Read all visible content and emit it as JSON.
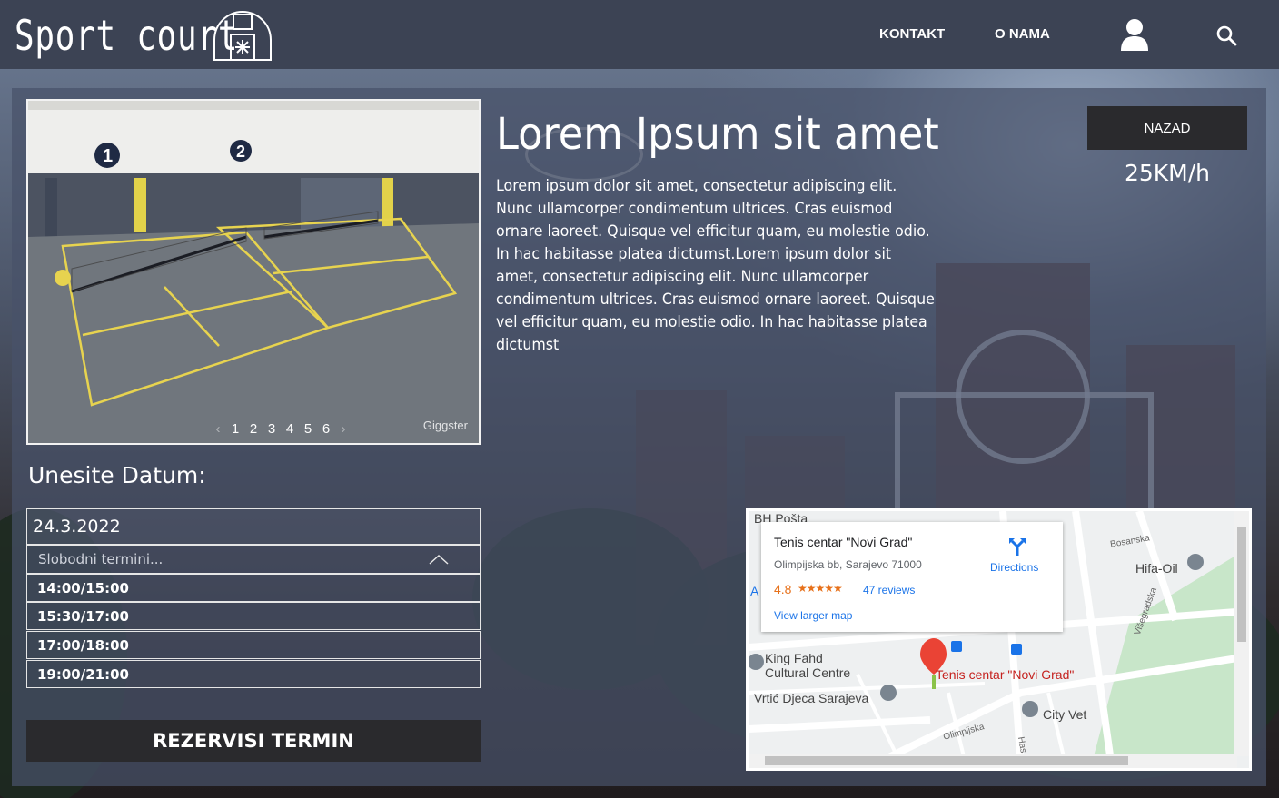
{
  "header": {
    "logo_text": "Sport court",
    "nav": [
      {
        "label": "KONTAKT"
      },
      {
        "label": "O NAMA"
      }
    ],
    "user_icon": "user-icon",
    "search_icon": "search-icon"
  },
  "gallery": {
    "pages": [
      "1",
      "2",
      "3",
      "4",
      "5",
      "6"
    ],
    "prev_arrow": "‹",
    "next_arrow": "›",
    "watermark": "Giggster"
  },
  "detail": {
    "title": "Lorem Ipsum sit amet",
    "description": "Lorem ipsum dolor sit amet, consectetur adipiscing elit. Nunc ullamcorper condimentum ultrices. Cras euismod ornare laoreet. Quisque vel efficitur quam, eu molestie odio. In hac habitasse platea dictumst.Lorem ipsum dolor sit amet, consectetur adipiscing elit. Nunc ullamcorper condimentum ultrices. Cras euismod ornare laoreet. Quisque vel efficitur quam, eu molestie odio. In hac habitasse platea dictumst",
    "back_label": "NAZAD",
    "speed": "25KM/h"
  },
  "booking": {
    "date_label": "Unesite Datum:",
    "date_value": "24.3.2022",
    "slots_placeholder": "Slobodni termini...",
    "slots": [
      "14:00/15:00",
      "15:30/17:00",
      "17:00/18:00",
      "19:00/21:00"
    ],
    "reserve_label": "REZERVISI TERMIN"
  },
  "map": {
    "place_name": "Tenis centar \"Novi Grad\"",
    "address": "Olimpijska bb, Sarajevo 71000",
    "rating": "4.8",
    "stars": "★★★★★",
    "reviews": "47 reviews",
    "view_larger": "View larger map",
    "directions": "Directions",
    "labels": {
      "bh_posta": "BH Pošta",
      "bosanska": "Bosanska",
      "hifa_oil": "Hifa-Oil",
      "visegradska": "Višegradska",
      "king_fahd_1": "King Fahd",
      "king_fahd_2": "Cultural Centre",
      "marker_label": "Tenis centar \"Novi Grad\"",
      "vrtic": "Vrtić Djeca Sarajeva",
      "city_vet": "City Vet",
      "olimpijska": "Olimpijska",
      "has": "Has",
      "a_edge": "A"
    },
    "colors": {
      "marker": "#ea4335",
      "park": "#c8e6c9",
      "link": "#1a73e8"
    }
  },
  "colors": {
    "header_bg": "#3c4354",
    "button_bg": "#2a2a2d",
    "panel_bg": "#48526a"
  }
}
